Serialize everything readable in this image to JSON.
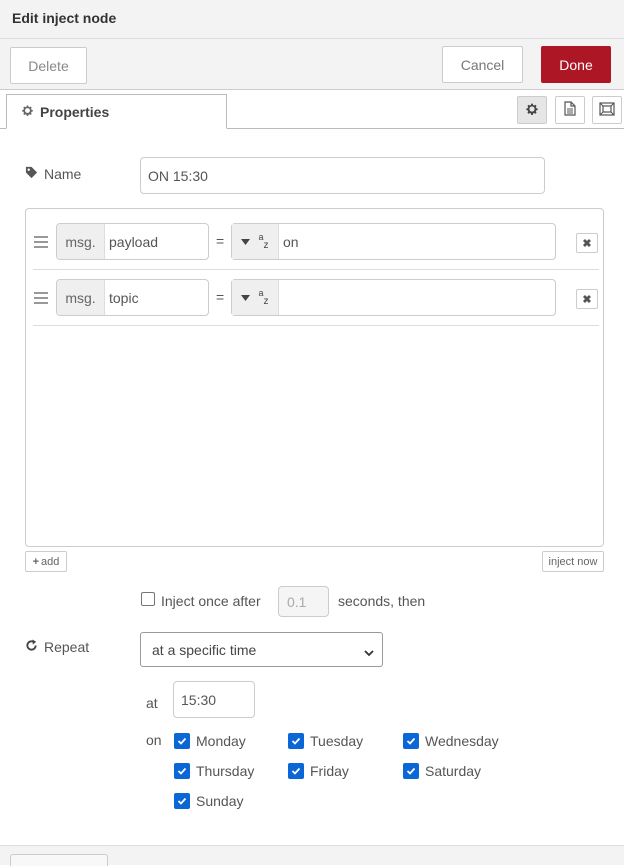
{
  "header": {
    "title": "Edit inject node"
  },
  "toolbar": {
    "delete_label": "Delete",
    "cancel_label": "Cancel",
    "done_label": "Done"
  },
  "tabs": [
    {
      "label": "Properties",
      "icon": "gear-icon"
    }
  ],
  "tab_icons": [
    "gear-icon",
    "document-icon",
    "frame-icon"
  ],
  "name": {
    "label": "Name",
    "value": "ON 15:30"
  },
  "properties": [
    {
      "prefix": "msg.",
      "key": "payload",
      "type_icon": "az",
      "value": "on"
    },
    {
      "prefix": "msg.",
      "key": "topic",
      "type_icon": "az",
      "value": ""
    }
  ],
  "equals_sign": "=",
  "add_label": "add",
  "inject_now_label": "inject now",
  "inject_once": {
    "checked": false,
    "label": "Inject once after",
    "delay": "0.1",
    "suffix": "seconds, then"
  },
  "repeat": {
    "label": "Repeat",
    "selected": "at a specific time"
  },
  "at": {
    "label": "at",
    "value": "15:30"
  },
  "on_label": "on",
  "days": [
    {
      "label": "Monday",
      "checked": true
    },
    {
      "label": "Tuesday",
      "checked": true
    },
    {
      "label": "Wednesday",
      "checked": true
    },
    {
      "label": "Thursday",
      "checked": true
    },
    {
      "label": "Friday",
      "checked": true
    },
    {
      "label": "Saturday",
      "checked": true
    },
    {
      "label": "Sunday",
      "checked": true
    }
  ],
  "colors": {
    "done": "#ad1625",
    "checkbox": "#0b66d6"
  }
}
